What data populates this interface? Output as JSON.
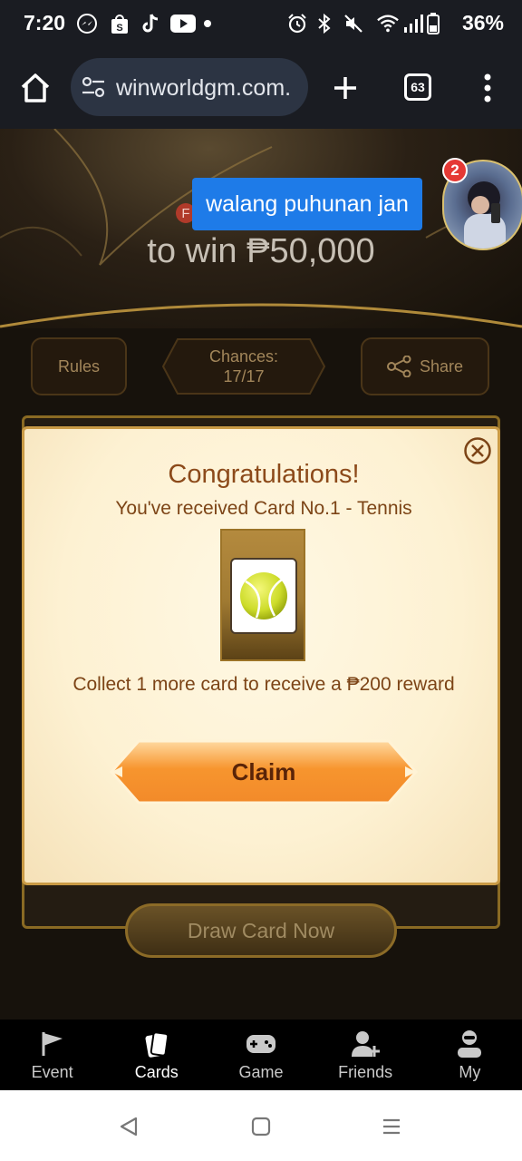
{
  "status_bar": {
    "time": "7:20",
    "battery": "36%",
    "icons": [
      "messenger-icon",
      "shopee-icon",
      "tiktok-icon",
      "youtube-icon",
      "dot-icon",
      "alarm-icon",
      "bluetooth-icon",
      "mute-icon",
      "wifi-icon",
      "signal-icon",
      "battery-icon"
    ]
  },
  "browser": {
    "url": "winworldgm.com.",
    "tab_count": "63",
    "icons": [
      "home-icon",
      "site-settings-icon",
      "plus-icon",
      "tabs-icon",
      "more-vert-icon"
    ]
  },
  "hero": {
    "badge": "F",
    "title": "to win ₱50,000"
  },
  "chat_head": {
    "message": "walang puhunan jan",
    "unread_count": "2"
  },
  "top_buttons": {
    "rules": "Rules",
    "chances_label": "Chances:",
    "chances_value": "17/17",
    "share": "Share"
  },
  "modal": {
    "title": "Congratulations!",
    "subtitle": "You've received Card No.1 - Tennis",
    "card_icon": "tennis-ball-icon",
    "collect_text": "Collect 1 more card to receive a ₱200 reward",
    "claim": "Claim"
  },
  "draw_button": "Draw Card Now",
  "bottom_nav": [
    {
      "label": "Event",
      "icon": "flag-icon",
      "active": false
    },
    {
      "label": "Cards",
      "icon": "cards-icon",
      "active": true
    },
    {
      "label": "Game",
      "icon": "gamepad-icon",
      "active": false
    },
    {
      "label": "Friends",
      "icon": "add-friend-icon",
      "active": false
    },
    {
      "label": "My",
      "icon": "profile-icon",
      "active": false
    }
  ],
  "system_nav": [
    "back-icon",
    "home-square-icon",
    "recents-icon"
  ],
  "colors": {
    "accent_gold": "#8a6a23",
    "modal_text": "#7c4416",
    "claim_orange": "#f28a2a",
    "chat_blue": "#1e7be8"
  }
}
